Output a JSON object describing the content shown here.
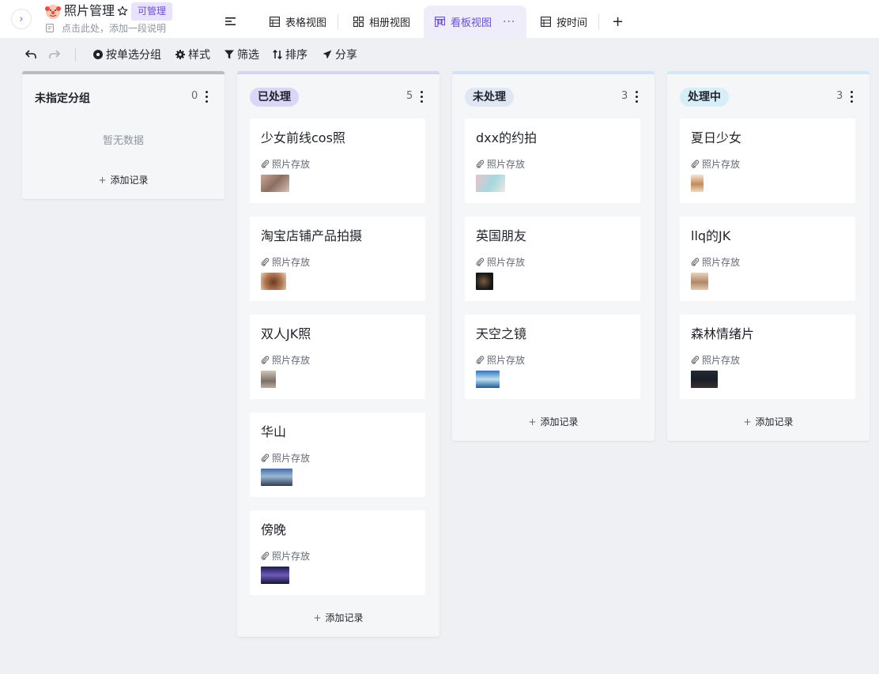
{
  "header": {
    "app_title": "照片管理",
    "permission_badge": "可管理",
    "description_placeholder": "点击此处，添加一段说明",
    "tabs": [
      {
        "label": "表格视图",
        "icon": "table-icon"
      },
      {
        "label": "相册视图",
        "icon": "gallery-icon"
      },
      {
        "label": "看板视图",
        "icon": "kanban-icon",
        "active": true
      },
      {
        "label": "按时间",
        "icon": "table-icon"
      }
    ],
    "add_view": "+"
  },
  "toolbar": {
    "group_by": "按单选分组",
    "style": "样式",
    "filter": "筛选",
    "sort": "排序",
    "share": "分享"
  },
  "board": {
    "field_name": "照片存放",
    "add_record": "添加记录",
    "empty_text": "暂无数据",
    "columns": [
      {
        "name": "未指定分组",
        "count": "0",
        "accent": "#b8bcc2",
        "cards": []
      },
      {
        "name": "已处理",
        "count": "5",
        "accent": "#d7d3f6",
        "pill": "#dad6f7",
        "cards": [
          "少女前线cos照",
          "淘宝店铺产品拍摄",
          "双人JK照",
          "华山",
          "傍晚"
        ]
      },
      {
        "name": "未处理",
        "count": "3",
        "accent": "#d3e2f8",
        "pill": "#dfe7f5",
        "cards": [
          "dxx的约拍",
          "英国朋友",
          "天空之镜"
        ]
      },
      {
        "name": "处理中",
        "count": "3",
        "accent": "#cdeaf5",
        "pill": "#d6eef7",
        "cards": [
          "夏日少女",
          "llq的JK",
          "森林情绪片"
        ]
      }
    ]
  },
  "colors": {
    "accent": "#6b4fd8",
    "tab_active_bg": "#eeedf9",
    "badge_bg": "#e8e2fc"
  }
}
